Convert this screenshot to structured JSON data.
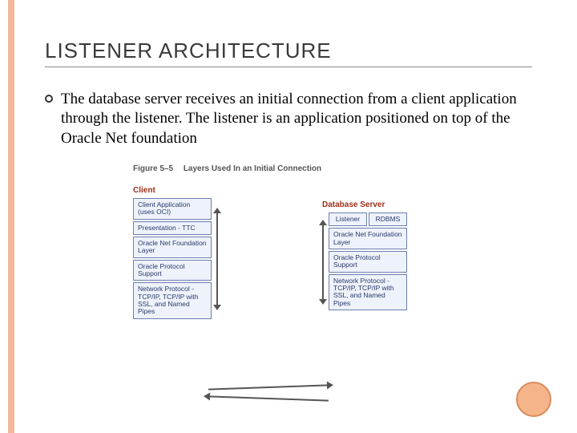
{
  "slide": {
    "title": "LISTENER ARCHITECTURE",
    "body": "The database server receives an initial connection from a client application through the listener. The listener is an application positioned on top of the Oracle Net foundation"
  },
  "figure": {
    "caption_num": "Figure 5–5",
    "caption_text": "Layers Used In an Initial Connection",
    "client_label": "Client",
    "server_label": "Database Server",
    "client_stack": [
      "Client Application (uses OCI)",
      "Presentation - TTC",
      "Oracle Net Foundation Layer",
      "Oracle Protocol Support",
      "Network Protocol - TCP/IP, TCP/IP with SSL, and Named Pipes"
    ],
    "server_top": {
      "left": "Listener",
      "right": "RDBMS"
    },
    "server_stack": [
      "Oracle Net Foundation Layer",
      "Oracle Protocol Support",
      "Network Protocol - TCP/IP, TCP/IP with SSL, and Named Pipes"
    ]
  }
}
